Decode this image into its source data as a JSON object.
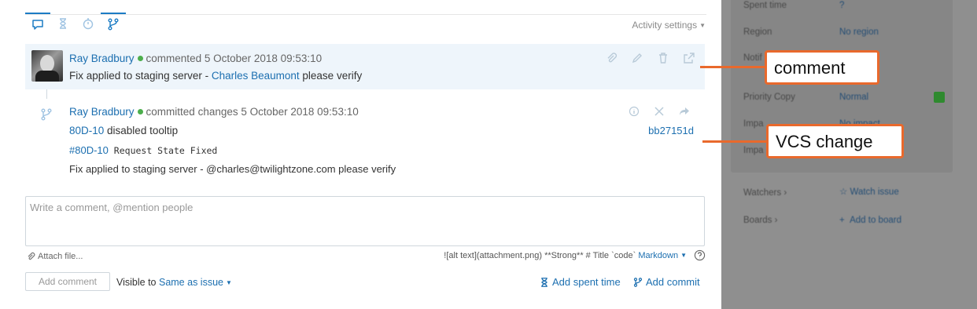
{
  "activity": {
    "tabs": [
      {
        "name": "comments-tab",
        "icon": "speech-bubble-icon",
        "active": true
      },
      {
        "name": "history-tab",
        "icon": "hourglass-icon",
        "active": false
      },
      {
        "name": "time-tab",
        "icon": "timer-icon",
        "active": false
      },
      {
        "name": "vcs-tab",
        "icon": "branch-icon",
        "active": true
      }
    ],
    "settings_label": "Activity settings"
  },
  "comment": {
    "author": "Ray Bradbury",
    "action": "commented 5 October 2018 09:53:10",
    "text_before": "Fix applied to staging server - ",
    "mention": "Charles Beaumont",
    "text_after": " please verify"
  },
  "vcs_change": {
    "author": "Ray Bradbury",
    "action": "committed changes 5 October 2018 09:53:10",
    "issue_id": "80D-10",
    "summary": " disabled tooltip",
    "hash": "bb27151d",
    "command_issue": "#80D-10",
    "command_text": " Request State Fixed",
    "message": "Fix applied to staging server - @charles@twilightzone.com please verify"
  },
  "editor": {
    "placeholder": "Write a comment, @mention people",
    "attach_label": "Attach file...",
    "markdown_hint": "![alt text](attachment.png) **Strong** # Title `code`",
    "markdown_label": "Markdown"
  },
  "footer": {
    "add_comment": "Add comment",
    "visible_prefix": "Visible to",
    "visible_value": "Same as issue",
    "add_spent_time": "Add spent time",
    "add_commit": "Add commit"
  },
  "sidebar": {
    "fields": [
      {
        "label": "Spent time",
        "value": "?"
      },
      {
        "label": "Region",
        "value": "No region"
      },
      {
        "label": "Notif",
        "value": ""
      },
      {
        "label": "Priority Copy",
        "value": "Normal"
      },
      {
        "label": "Impa",
        "value": "No impact"
      },
      {
        "label": "Impa",
        "value": ""
      }
    ],
    "watchers_label": "Watchers",
    "watch_link": "Watch issue",
    "boards_label": "Boards",
    "add_board_link": "Add to board"
  },
  "callouts": {
    "comment": "comment",
    "vcs": "VCS change"
  },
  "colors": {
    "accent": "#1c6fb0",
    "callout": "#e9692c",
    "online": "#4cae4c"
  }
}
